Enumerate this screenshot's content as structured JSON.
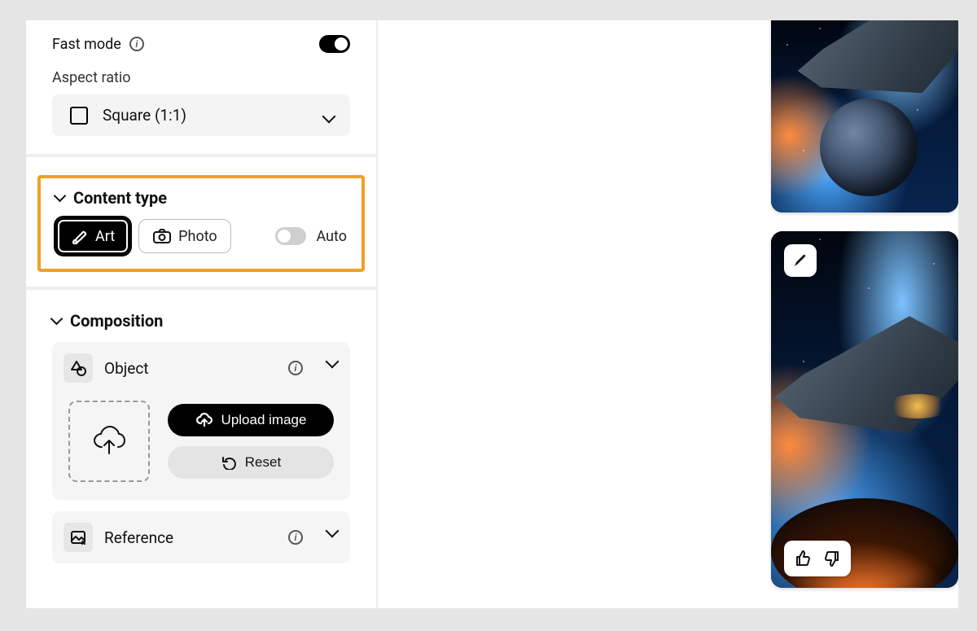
{
  "sidebar": {
    "fastMode": {
      "label": "Fast mode",
      "enabled": true
    },
    "aspectRatio": {
      "label": "Aspect ratio",
      "value": "Square (1:1)"
    },
    "contentType": {
      "title": "Content type",
      "options": {
        "art": "Art",
        "photo": "Photo"
      },
      "selected": "art",
      "auto": {
        "label": "Auto",
        "enabled": false
      }
    },
    "composition": {
      "title": "Composition",
      "object": {
        "title": "Object",
        "uploadLabel": "Upload image",
        "resetLabel": "Reset"
      },
      "reference": {
        "title": "Reference"
      }
    }
  }
}
